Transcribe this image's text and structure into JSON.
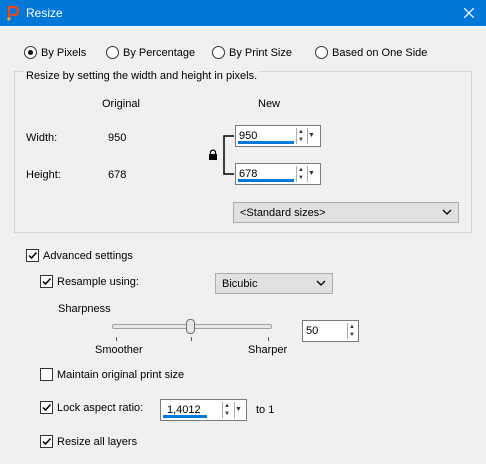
{
  "window": {
    "title": "Resize",
    "close_icon": "close-icon",
    "app_icon": "paintshop-icon"
  },
  "modes": {
    "selected": "by_pixels",
    "items": [
      {
        "id": "by_pixels",
        "label": "By Pixels"
      },
      {
        "id": "by_percentage",
        "label": "By Percentage"
      },
      {
        "id": "by_print_size",
        "label": "By Print Size"
      },
      {
        "id": "one_side",
        "label": "Based on One Side"
      }
    ]
  },
  "pixel_group": {
    "caption": "Resize by setting the width and height in pixels.",
    "original_header": "Original",
    "new_header": "New",
    "width_label": "Width:",
    "height_label": "Height:",
    "original_width": "950",
    "original_height": "678",
    "new_width": "950",
    "new_height": "678",
    "standard_sizes": "<Standard sizes>"
  },
  "advanced": {
    "label": "Advanced settings",
    "checked": true,
    "resample_label": "Resample using:",
    "resample_checked": true,
    "resample_method": "Bicubic",
    "sharpness_label": "Sharpness",
    "smoother_label": "Smoother",
    "sharper_label": "Sharper",
    "sharpness_value": "50",
    "maintain_label": "Maintain original print size",
    "maintain_checked": false,
    "lock_label": "Lock aspect ratio:",
    "lock_checked": true,
    "ratio_value": "1,4012",
    "ratio_suffix": "to 1",
    "resize_layers_label": "Resize all layers",
    "resize_layers_checked": true
  },
  "colors": {
    "titlebar": "#0078d7",
    "accent": "#0078d7",
    "background": "#f0f0f0"
  }
}
